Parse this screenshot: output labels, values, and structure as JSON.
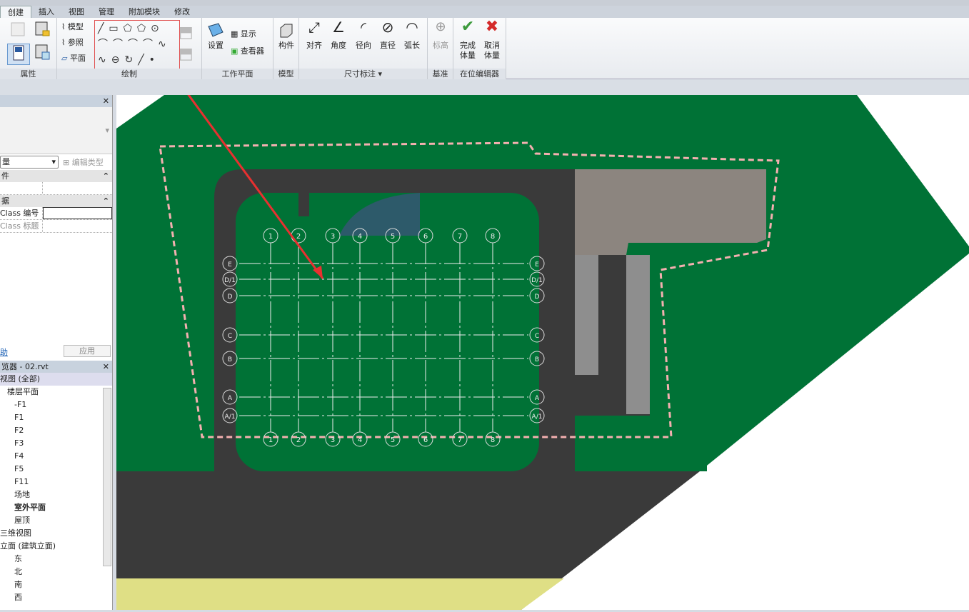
{
  "tabs": [
    "创建",
    "插入",
    "视图",
    "管理",
    "附加模块",
    "修改"
  ],
  "ribbon": {
    "panels": {
      "properties": "属性",
      "draw": "绘制",
      "workplane": "工作平面",
      "model": "模型",
      "dimension": "尺寸标注 ▾",
      "datum": "基准",
      "inplace": "在位编辑器"
    },
    "draw_items": {
      "model": "模型",
      "ref": "参照",
      "plane": "平面"
    },
    "workplane": {
      "set": "设置",
      "show": "显示",
      "viewer": "查看器"
    },
    "component": "构件",
    "dims": [
      "对齐",
      "角度",
      "径向",
      "直径",
      "弧长"
    ],
    "level": "标高",
    "finish": "完成\n体量",
    "cancel": "取消\n体量",
    "colors": {
      "finish": "#3c9a3c",
      "cancel": "#d42a2a"
    }
  },
  "properties": {
    "type_select": "量",
    "edit_type": "编辑类型",
    "group1": "件",
    "group2": "据",
    "rows": [
      {
        "label": "Class 编号",
        "value": ""
      },
      {
        "label": "Class 标题",
        "value": ""
      }
    ],
    "help": "助",
    "apply": "应用"
  },
  "browser": {
    "title": "览器 - 02.rvt",
    "items": [
      "视图 (全部)",
      "楼层平面",
      "-F1",
      "F1",
      "F2",
      "F3",
      "F4",
      "F5",
      "F11",
      "场地",
      "室外平面",
      "屋顶",
      "三维视图",
      "立面 (建筑立面)",
      "东",
      "北",
      "南",
      "西"
    ]
  },
  "grid": {
    "columns": [
      "1",
      "2",
      "3",
      "4",
      "5",
      "6",
      "7",
      "8"
    ],
    "rows": [
      "E",
      "D/1",
      "D",
      "C",
      "B",
      "A",
      "A/1"
    ]
  }
}
